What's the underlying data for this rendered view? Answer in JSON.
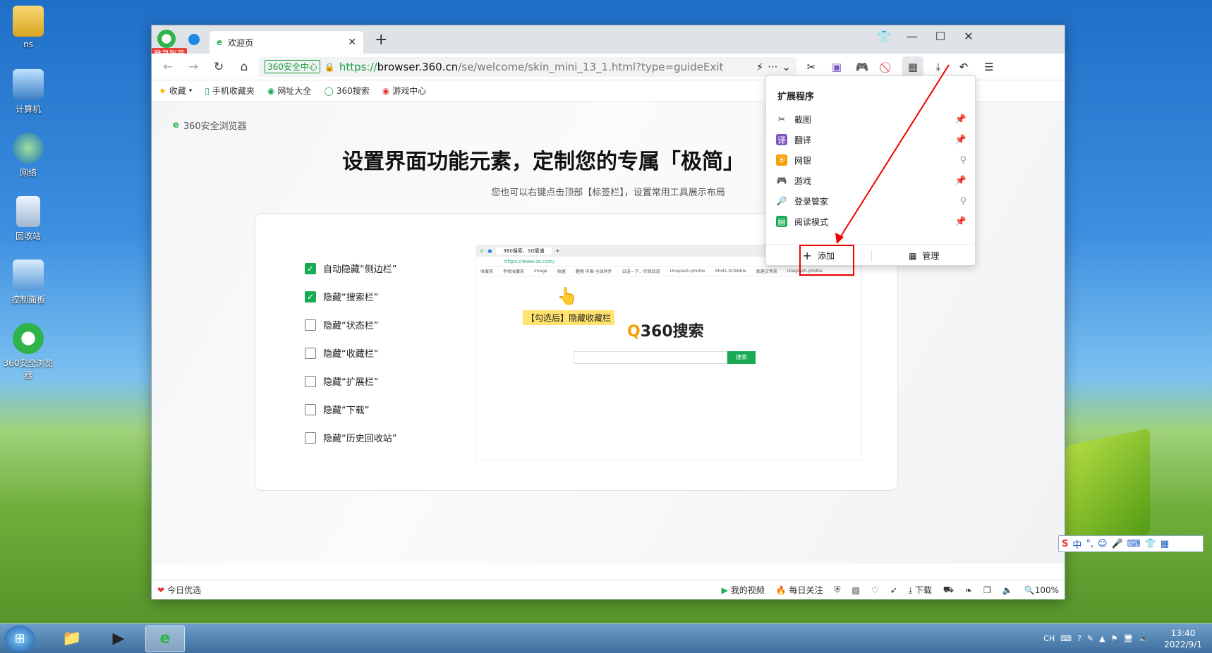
{
  "desktop": {
    "icons": [
      {
        "label": "ns"
      },
      {
        "label": "计算机"
      },
      {
        "label": "网络"
      },
      {
        "label": "回收站"
      },
      {
        "label": "控制面板"
      },
      {
        "label": "360安全浏览器"
      }
    ]
  },
  "browser": {
    "login_badge": "登录账号",
    "tab_title": "欢迎页",
    "new_tab_symbol": "+",
    "addr_security": "360安全中心",
    "url_proto": "https://",
    "url_host": "browser.360.cn",
    "url_path": "/se/welcome/skin_mini_13_1.html?type=guideExit",
    "bookmarks": [
      "收藏",
      "手机收藏夹",
      "网址大全",
      "360搜索",
      "游戏中心"
    ]
  },
  "page": {
    "brand": "360安全浏览器",
    "headline": "设置界面功能元素，定制您的专属「极简」",
    "subtitle": "您也可以右键点击顶部【标签栏】，设置常用工具展示布局",
    "options": [
      {
        "label": "自动隐藏“侧边栏”",
        "checked": true
      },
      {
        "label": "隐藏“搜索栏”",
        "checked": true
      },
      {
        "label": "隐藏“状态栏”",
        "checked": false
      },
      {
        "label": "隐藏“收藏栏”",
        "checked": false
      },
      {
        "label": "隐藏“扩展栏”",
        "checked": false
      },
      {
        "label": "隐藏“下载”",
        "checked": false
      },
      {
        "label": "隐藏“历史回收站”",
        "checked": false
      }
    ],
    "preview": {
      "tab": "360搜索，SO靠谱",
      "url": "https://www.so.com/",
      "bm": [
        "收藏夹",
        "手机收藏夹",
        "image",
        "收据",
        "趣物 中国·全球同步",
        "日语一下，你就知道",
        "Unsplash-photos",
        "Shots Dribbble",
        "新建文件夹",
        "Unsplash-photos"
      ],
      "hint": "【勾选后】隐藏收藏栏",
      "logo_prefix": "Q",
      "logo": "360搜索",
      "search_btn": "搜索"
    }
  },
  "ext_menu": {
    "title": "扩展程序",
    "items": [
      {
        "label": "截图",
        "pinned": true
      },
      {
        "label": "翻译",
        "pinned": true
      },
      {
        "label": "网银",
        "pinned": false
      },
      {
        "label": "游戏",
        "pinned": true
      },
      {
        "label": "登录管家",
        "pinned": false
      },
      {
        "label": "阅读模式",
        "pinned": true
      }
    ],
    "add": "添加",
    "manage": "管理"
  },
  "status": {
    "left": "今日优选",
    "video": "我的视频",
    "follow": "每日关注",
    "download": "下载",
    "zoom": "100%"
  },
  "ime": {
    "lang": "中"
  },
  "taskbar": {
    "lang": "CH",
    "time": "13:40",
    "date": "2022/9/1"
  },
  "colors": {
    "accent": "#1aaa55",
    "annotation": "#e00000"
  }
}
